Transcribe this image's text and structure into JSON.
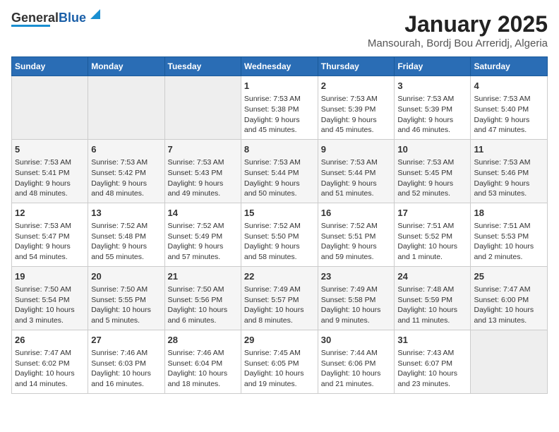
{
  "logo": {
    "line1": "General",
    "line2": "Blue"
  },
  "title": "January 2025",
  "subtitle": "Mansourah, Bordj Bou Arreridj, Algeria",
  "days_of_week": [
    "Sunday",
    "Monday",
    "Tuesday",
    "Wednesday",
    "Thursday",
    "Friday",
    "Saturday"
  ],
  "weeks": [
    [
      {
        "day": "",
        "content": ""
      },
      {
        "day": "",
        "content": ""
      },
      {
        "day": "",
        "content": ""
      },
      {
        "day": "1",
        "content": "Sunrise: 7:53 AM\nSunset: 5:38 PM\nDaylight: 9 hours\nand 45 minutes."
      },
      {
        "day": "2",
        "content": "Sunrise: 7:53 AM\nSunset: 5:39 PM\nDaylight: 9 hours\nand 45 minutes."
      },
      {
        "day": "3",
        "content": "Sunrise: 7:53 AM\nSunset: 5:39 PM\nDaylight: 9 hours\nand 46 minutes."
      },
      {
        "day": "4",
        "content": "Sunrise: 7:53 AM\nSunset: 5:40 PM\nDaylight: 9 hours\nand 47 minutes."
      }
    ],
    [
      {
        "day": "5",
        "content": "Sunrise: 7:53 AM\nSunset: 5:41 PM\nDaylight: 9 hours\nand 48 minutes."
      },
      {
        "day": "6",
        "content": "Sunrise: 7:53 AM\nSunset: 5:42 PM\nDaylight: 9 hours\nand 48 minutes."
      },
      {
        "day": "7",
        "content": "Sunrise: 7:53 AM\nSunset: 5:43 PM\nDaylight: 9 hours\nand 49 minutes."
      },
      {
        "day": "8",
        "content": "Sunrise: 7:53 AM\nSunset: 5:44 PM\nDaylight: 9 hours\nand 50 minutes."
      },
      {
        "day": "9",
        "content": "Sunrise: 7:53 AM\nSunset: 5:44 PM\nDaylight: 9 hours\nand 51 minutes."
      },
      {
        "day": "10",
        "content": "Sunrise: 7:53 AM\nSunset: 5:45 PM\nDaylight: 9 hours\nand 52 minutes."
      },
      {
        "day": "11",
        "content": "Sunrise: 7:53 AM\nSunset: 5:46 PM\nDaylight: 9 hours\nand 53 minutes."
      }
    ],
    [
      {
        "day": "12",
        "content": "Sunrise: 7:53 AM\nSunset: 5:47 PM\nDaylight: 9 hours\nand 54 minutes."
      },
      {
        "day": "13",
        "content": "Sunrise: 7:52 AM\nSunset: 5:48 PM\nDaylight: 9 hours\nand 55 minutes."
      },
      {
        "day": "14",
        "content": "Sunrise: 7:52 AM\nSunset: 5:49 PM\nDaylight: 9 hours\nand 57 minutes."
      },
      {
        "day": "15",
        "content": "Sunrise: 7:52 AM\nSunset: 5:50 PM\nDaylight: 9 hours\nand 58 minutes."
      },
      {
        "day": "16",
        "content": "Sunrise: 7:52 AM\nSunset: 5:51 PM\nDaylight: 9 hours\nand 59 minutes."
      },
      {
        "day": "17",
        "content": "Sunrise: 7:51 AM\nSunset: 5:52 PM\nDaylight: 10 hours\nand 1 minute."
      },
      {
        "day": "18",
        "content": "Sunrise: 7:51 AM\nSunset: 5:53 PM\nDaylight: 10 hours\nand 2 minutes."
      }
    ],
    [
      {
        "day": "19",
        "content": "Sunrise: 7:50 AM\nSunset: 5:54 PM\nDaylight: 10 hours\nand 3 minutes."
      },
      {
        "day": "20",
        "content": "Sunrise: 7:50 AM\nSunset: 5:55 PM\nDaylight: 10 hours\nand 5 minutes."
      },
      {
        "day": "21",
        "content": "Sunrise: 7:50 AM\nSunset: 5:56 PM\nDaylight: 10 hours\nand 6 minutes."
      },
      {
        "day": "22",
        "content": "Sunrise: 7:49 AM\nSunset: 5:57 PM\nDaylight: 10 hours\nand 8 minutes."
      },
      {
        "day": "23",
        "content": "Sunrise: 7:49 AM\nSunset: 5:58 PM\nDaylight: 10 hours\nand 9 minutes."
      },
      {
        "day": "24",
        "content": "Sunrise: 7:48 AM\nSunset: 5:59 PM\nDaylight: 10 hours\nand 11 minutes."
      },
      {
        "day": "25",
        "content": "Sunrise: 7:47 AM\nSunset: 6:00 PM\nDaylight: 10 hours\nand 13 minutes."
      }
    ],
    [
      {
        "day": "26",
        "content": "Sunrise: 7:47 AM\nSunset: 6:02 PM\nDaylight: 10 hours\nand 14 minutes."
      },
      {
        "day": "27",
        "content": "Sunrise: 7:46 AM\nSunset: 6:03 PM\nDaylight: 10 hours\nand 16 minutes."
      },
      {
        "day": "28",
        "content": "Sunrise: 7:46 AM\nSunset: 6:04 PM\nDaylight: 10 hours\nand 18 minutes."
      },
      {
        "day": "29",
        "content": "Sunrise: 7:45 AM\nSunset: 6:05 PM\nDaylight: 10 hours\nand 19 minutes."
      },
      {
        "day": "30",
        "content": "Sunrise: 7:44 AM\nSunset: 6:06 PM\nDaylight: 10 hours\nand 21 minutes."
      },
      {
        "day": "31",
        "content": "Sunrise: 7:43 AM\nSunset: 6:07 PM\nDaylight: 10 hours\nand 23 minutes."
      },
      {
        "day": "",
        "content": ""
      }
    ]
  ]
}
